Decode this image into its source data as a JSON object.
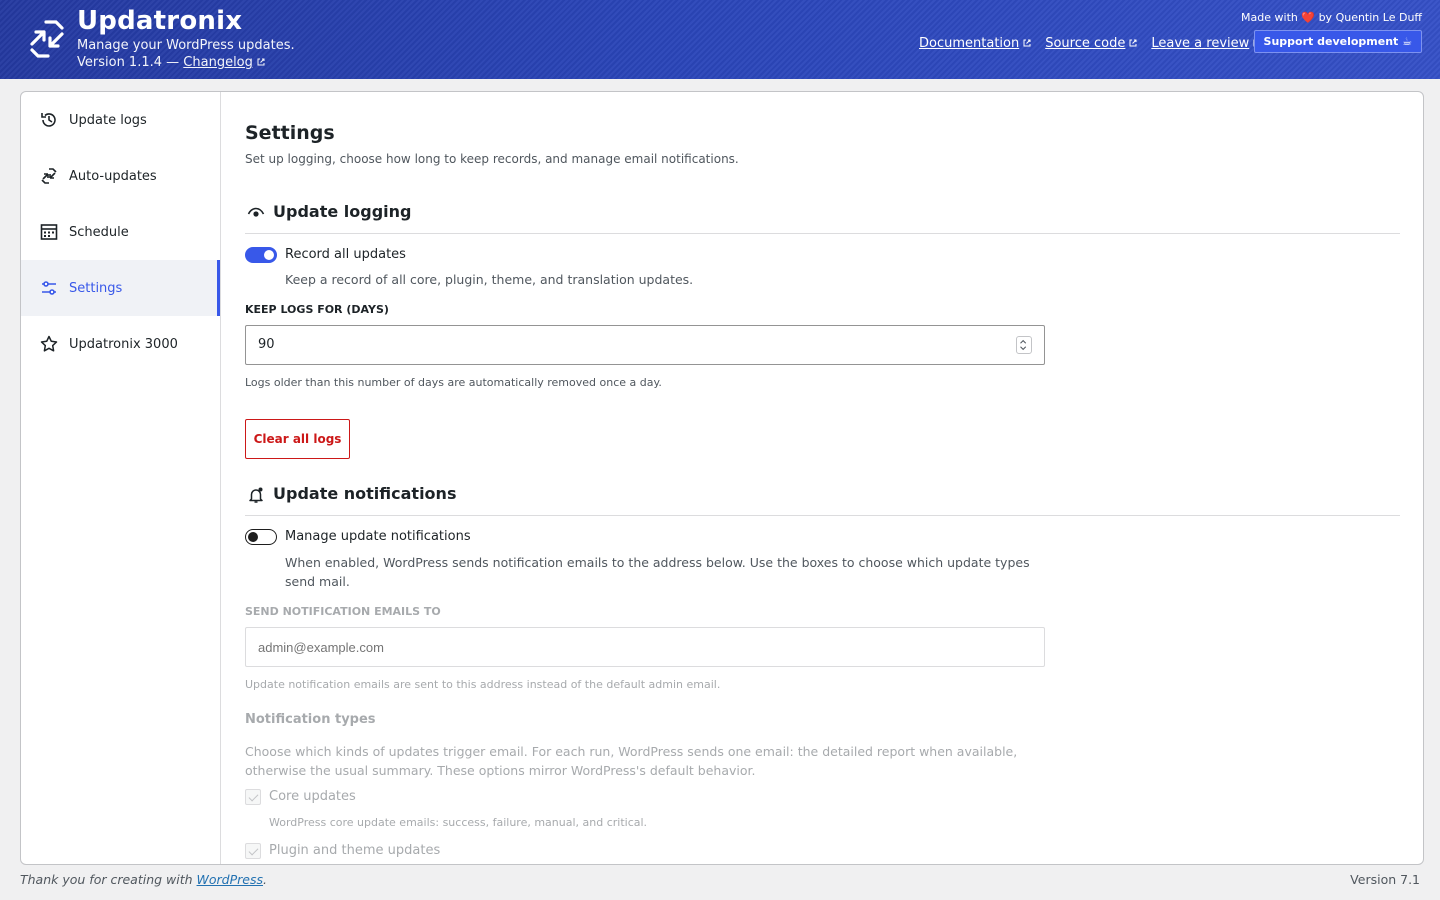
{
  "header": {
    "title": "Updatronix",
    "tagline": "Manage your WordPress updates.",
    "version_prefix": "Version 1.1.4 —",
    "changelog_label": "Changelog",
    "links": [
      "Documentation",
      "Source code",
      "Leave a review"
    ],
    "made_with_prefix": "Made with",
    "made_with_heart": "❤️",
    "made_with_suffix": "by Quentin Le Duff",
    "support_label": "Support development ☕"
  },
  "sidebar": {
    "items": [
      {
        "label": "Update logs",
        "icon": "history-icon"
      },
      {
        "label": "Auto-updates",
        "icon": "update-icon"
      },
      {
        "label": "Schedule",
        "icon": "calendar-icon"
      },
      {
        "label": "Settings",
        "icon": "settings-sliders-icon",
        "active": true
      },
      {
        "label": "Updatronix 3000",
        "icon": "star-icon"
      }
    ]
  },
  "settings": {
    "title": "Settings",
    "description": "Set up logging, choose how long to keep records, and manage email notifications.",
    "logging": {
      "heading": "Update logging",
      "record_label": "Record all updates",
      "record_help": "Keep a record of all core, plugin, theme, and translation updates.",
      "record_enabled": true,
      "keep_label": "Keep logs for (days)",
      "keep_value": "90",
      "keep_help": "Logs older than this number of days are automatically removed once a day.",
      "clear_label": "Clear all logs"
    },
    "notifications": {
      "heading": "Update notifications",
      "manage_label": "Manage update notifications",
      "manage_help": "When enabled, WordPress sends notification emails to the address below. Use the boxes to choose which update types send mail.",
      "manage_enabled": false,
      "email_label": "Send notification emails to",
      "email_placeholder": "admin@example.com",
      "email_help": "Update notification emails are sent to this address instead of the default admin email.",
      "types_title": "Notification types",
      "types_desc": "Choose which kinds of updates trigger email. For each run, WordPress sends one email: the detailed report when available, otherwise the usual summary. These options mirror WordPress's default behavior.",
      "core_label": "Core updates",
      "core_help": "WordPress core update emails: success, failure, manual, and critical.",
      "plugin_label": "Plugin and theme updates"
    }
  },
  "footer": {
    "thanks_prefix": "Thank you for creating with",
    "thanks_link": "WordPress",
    "thanks_suffix": ".",
    "version": "Version 7.1"
  },
  "colors": {
    "accent": "#3858e9",
    "danger": "#cc1818",
    "header": "#2a45b8"
  }
}
